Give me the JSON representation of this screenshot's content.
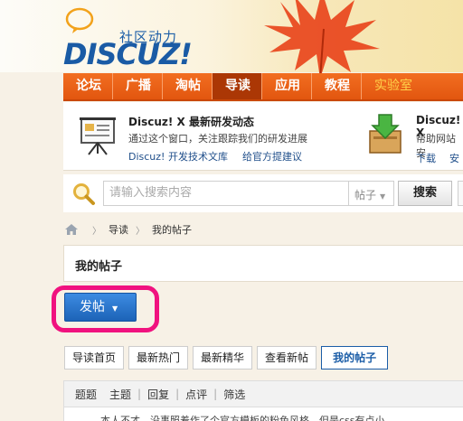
{
  "logo": {
    "tagline": "社区动力",
    "wordmark": "DISCUZ!"
  },
  "nav": {
    "items": [
      "论坛",
      "广播",
      "淘帖",
      "导读",
      "应用",
      "教程",
      "实验室"
    ],
    "active_index": 3
  },
  "promo": {
    "left": {
      "title": "Discuz! X 最新研发动态",
      "subtitle": "通过这个窗口，关注跟踪我们的研发进展",
      "link1": "Discuz! 开发技术文库",
      "link2": "给官方提建议"
    },
    "right": {
      "title": "Discuz! X",
      "subtitle": "帮助网站安",
      "link1": "下载",
      "link2": "安"
    }
  },
  "search": {
    "placeholder": "请输入搜索内容",
    "type_selected": "帖子",
    "button_label": "搜索"
  },
  "breadcrumb": {
    "items": [
      "导读",
      "我的帖子"
    ]
  },
  "page_title": "我的帖子",
  "post_button_label": "发帖",
  "tabs": {
    "items": [
      "导读首页",
      "最新热门",
      "最新精华",
      "查看新帖",
      "我的帖子"
    ],
    "active_index": 4
  },
  "filters": [
    "题题",
    "主题",
    "回复",
    "点评",
    "筛选"
  ],
  "list_row_text": "本人不才，没事照着作了个官方模板的粉色风格，但是css有点小",
  "colors": {
    "nav_orange": "#f26e21",
    "brand_blue": "#1a5ba5",
    "highlight_pink": "#f0127f"
  }
}
